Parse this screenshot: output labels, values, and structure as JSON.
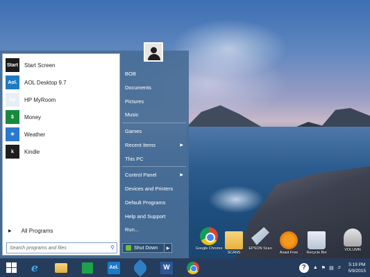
{
  "start_menu": {
    "programs": [
      {
        "label": "Start Screen",
        "tile": "Start"
      },
      {
        "label": "AOL Desktop 9.7",
        "tile": "Aol."
      },
      {
        "label": "HP MyRoom",
        "tile": "hp"
      },
      {
        "label": "Money",
        "tile": "$"
      },
      {
        "label": "Weather",
        "tile": "☀"
      },
      {
        "label": "Kindle",
        "tile": "k"
      }
    ],
    "all_programs": "All Programs",
    "search_placeholder": "Search programs and files",
    "user": "BOB",
    "right_items": [
      {
        "label": "Documents"
      },
      {
        "label": "Pictures"
      },
      {
        "label": "Music"
      },
      {
        "label": "Games"
      },
      {
        "label": "Recent Items"
      },
      {
        "label": "This PC"
      },
      {
        "label": "Control Panel"
      },
      {
        "label": "Devices and Printers"
      },
      {
        "label": "Default Programs"
      },
      {
        "label": "Help and Support"
      },
      {
        "label": "Run..."
      }
    ],
    "shutdown_label": "Shut Down"
  },
  "desktop_icons": [
    {
      "label": "Google Chrome",
      "icon": "chrome-icon"
    },
    {
      "label": "SCANS",
      "icon": "folder-icon"
    },
    {
      "label": "EPSON Scan",
      "icon": "scanner-icon"
    },
    {
      "label": "Avast Free",
      "icon": "avast-icon"
    },
    {
      "label": "Recycle Bin",
      "icon": "recycle-bin-icon"
    },
    {
      "label": "VOLUMN",
      "icon": "volume-icon"
    }
  ],
  "taskbar": {
    "aol_label": "Aol.",
    "word_label": "W",
    "clock_time": "5:19 PM",
    "clock_date": "5/9/2015",
    "help_label": "?"
  },
  "colors": {
    "menu_right": "#486e96",
    "accent": "#2c6db3"
  }
}
